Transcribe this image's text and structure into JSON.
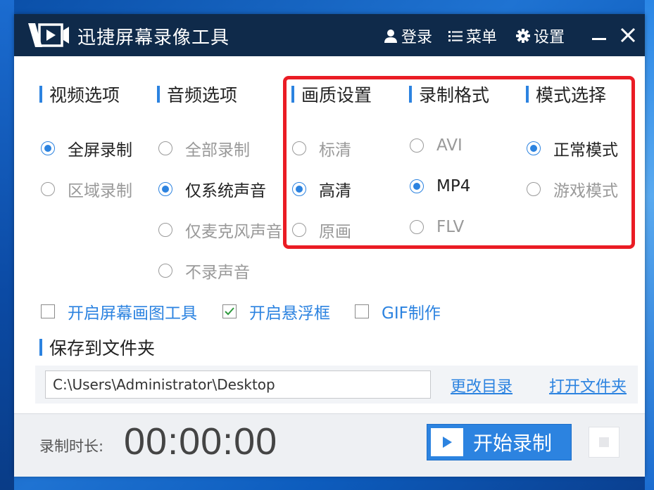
{
  "window": {
    "title": "迅捷屏幕录像工具",
    "login": "登录",
    "menu": "菜单",
    "settings": "设置"
  },
  "video": {
    "title": "视频选项",
    "options": [
      {
        "label": "全屏录制",
        "selected": true
      },
      {
        "label": "区域录制",
        "selected": false
      }
    ]
  },
  "audio": {
    "title": "音频选项",
    "options": [
      {
        "label": "全部录制",
        "selected": false
      },
      {
        "label": "仅系统声音",
        "selected": true
      },
      {
        "label": "仅麦克风声音",
        "selected": false
      },
      {
        "label": "不录声音",
        "selected": false
      }
    ]
  },
  "quality": {
    "title": "画质设置",
    "options": [
      {
        "label": "标清",
        "selected": false
      },
      {
        "label": "高清",
        "selected": true
      },
      {
        "label": "原画",
        "selected": false
      }
    ]
  },
  "format": {
    "title": "录制格式",
    "options": [
      {
        "label": "AVI",
        "selected": false
      },
      {
        "label": "MP4",
        "selected": true
      },
      {
        "label": "FLV",
        "selected": false
      }
    ]
  },
  "mode": {
    "title": "模式选择",
    "options": [
      {
        "label": "正常模式",
        "selected": true
      },
      {
        "label": "游戏模式",
        "selected": false
      }
    ]
  },
  "checkboxes": [
    {
      "label": "开启屏幕画图工具",
      "checked": false
    },
    {
      "label": "开启悬浮框",
      "checked": true
    },
    {
      "label": "GIF制作",
      "checked": false
    }
  ],
  "save": {
    "title": "保存到文件夹",
    "path": "C:\\Users\\Administrator\\Desktop",
    "change_dir": "更改目录",
    "open_folder": "打开文件夹"
  },
  "footer": {
    "duration_label": "录制时长:",
    "duration": "00:00:00",
    "start_label": "开始录制"
  },
  "colors": {
    "accent": "#2c83e0",
    "titlebar": "#0f2a4a",
    "highlight": "#ea1c24"
  }
}
